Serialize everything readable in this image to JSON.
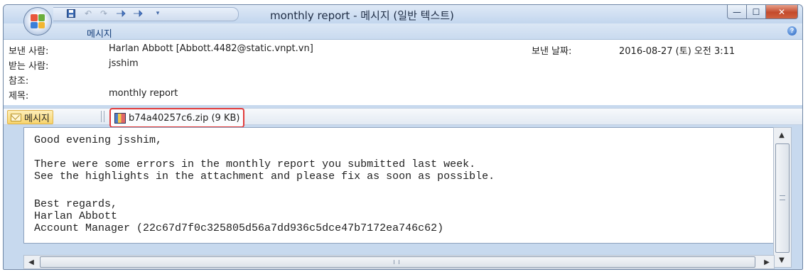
{
  "window": {
    "title": "monthly report - 메시지 (일반 텍스트)",
    "ribbon_tab": "메시지",
    "min_button": "—",
    "max_button": "☐",
    "close_button": "✕"
  },
  "header": {
    "from_label": "보낸 사람:",
    "from_value": "Harlan Abbott [Abbott.4482@static.vnpt.vn]",
    "to_label": "받는 사람:",
    "to_value": "jsshim",
    "cc_label": "참조:",
    "cc_value": "",
    "subject_label": "제목:",
    "subject_value": "monthly report",
    "sent_label": "보낸 날짜:",
    "sent_value": "2016-08-27 (토) 오전 3:11"
  },
  "attachments": {
    "message_tab": "메시지",
    "file": "b74a40257c6.zip (9 KB)"
  },
  "body": {
    "lines": [
      "Good evening jsshim,",
      "",
      "There were some errors in the monthly report you submitted last week.",
      "See the highlights in the attachment and please fix as soon as possible.",
      "",
      "",
      "Best regards,",
      "Harlan Abbott",
      "Account Manager (22c67d7f0c325805d56a7dd936c5dce47b7172ea746c62)"
    ]
  },
  "colors": {
    "highlight_border": "#e23b3b",
    "window_frame": "#c7d9ee"
  },
  "icons": {
    "office_button": "office-logo-icon",
    "save": "save-icon",
    "undo": "undo-icon",
    "redo": "redo-icon",
    "previous": "arrow-up-icon",
    "next": "arrow-down-icon",
    "qat_more": "chevron-down-icon",
    "help": "help-icon",
    "message": "envelope-icon",
    "attachment": "zip-icon"
  }
}
